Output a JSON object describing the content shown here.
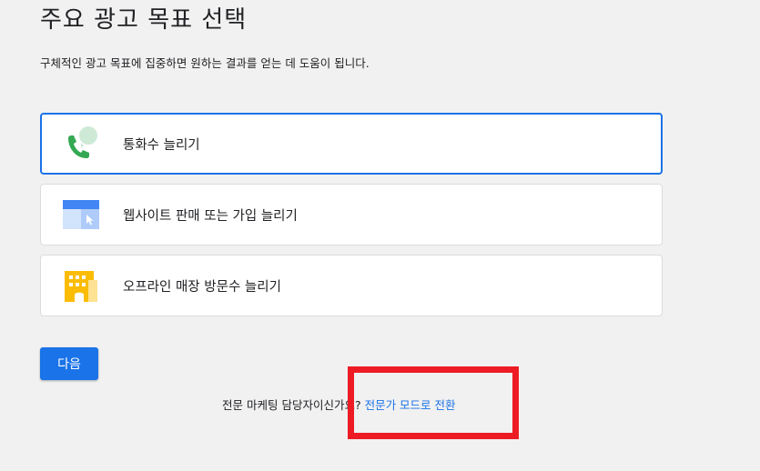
{
  "header": {
    "title": "주요 광고 목표 선택",
    "subtitle": "구체적인 광고 목표에 집중하면 원하는 결과를 얻는 데 도움이 됩니다."
  },
  "options": [
    {
      "label": "통화수 늘리기",
      "icon": "phone-call-icon",
      "selected": true
    },
    {
      "label": "웹사이트 판매 또는 가입 늘리기",
      "icon": "website-icon",
      "selected": false
    },
    {
      "label": "오프라인 매장 방문수 늘리기",
      "icon": "store-building-icon",
      "selected": false
    }
  ],
  "actions": {
    "next_label": "다음"
  },
  "expert": {
    "question": "전문 마케팅 담당자이신가요?",
    "link": "전문가 모드로 전환"
  },
  "colors": {
    "accent": "#1a73e8",
    "highlight": "#ed1c24",
    "phone_green": "#34a853",
    "building_yellow": "#fbbc04"
  }
}
